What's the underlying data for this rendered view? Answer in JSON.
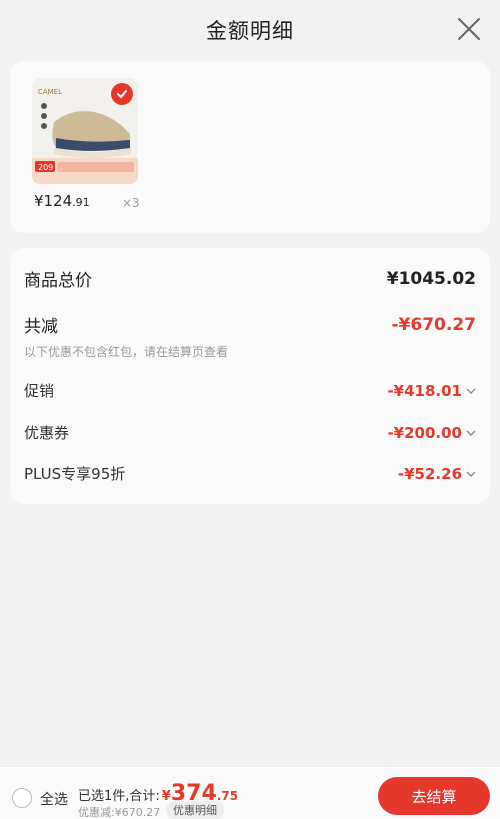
{
  "header": {
    "title": "金额明细"
  },
  "product": {
    "brand": "CAMEL",
    "tag_price": "209",
    "price_int": "¥124",
    "price_dec": ".91",
    "quantity": "×3"
  },
  "summary": {
    "total_label": "商品总价",
    "total_value": "¥1045.02",
    "discount_label": "共减",
    "discount_value": "-¥670.27",
    "note": "以下优惠不包含红包，请在结算页查看",
    "items": [
      {
        "label": "促销",
        "value": "-¥418.01"
      },
      {
        "label": "优惠券",
        "value": "-¥200.00"
      },
      {
        "label": "PLUS专享95折",
        "value": "-¥52.26"
      }
    ]
  },
  "footer": {
    "select_all": "全选",
    "selected_text": "已选1件,合计:",
    "currency": "¥",
    "amount_int": "374",
    "amount_dec": ".75",
    "discount_line": "优惠减:¥670.27",
    "detail_label": "优惠明细",
    "checkout_label": "去结算"
  },
  "colors": {
    "accent": "#e33a2c"
  }
}
